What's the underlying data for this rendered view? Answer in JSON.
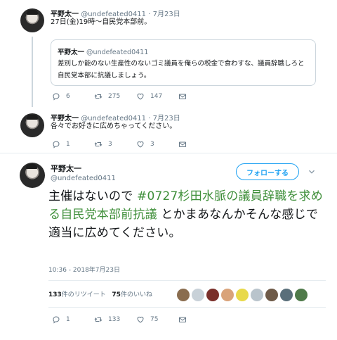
{
  "tweets": [
    {
      "name": "平野太一",
      "handle": "@undefeated0411",
      "dot": "·",
      "date": "7月23日",
      "text": "27日(金)19時～自民党本部前。",
      "quote": {
        "name": "平野太一",
        "handle": "@undefeated0411",
        "text": "差別しか能のない生産性のないゴミ議員を俺らの税金で食わすな、議員辞職しろと自民党本部に抗議しましょう。"
      },
      "replies": "6",
      "retweets": "275",
      "likes": "147"
    },
    {
      "name": "平野太一",
      "handle": "@undefeated0411",
      "dot": "·",
      "date": "7月23日",
      "text": "各々でお好きに広めちゃってください。",
      "replies": "1",
      "retweets": "3",
      "likes": "3"
    }
  ],
  "main": {
    "name": "平野太一",
    "handle": "@undefeated0411",
    "follow_label": "フォローする",
    "text_before": "主催はないので",
    "hashtag": "#0727杉田水脈の議員辞職を求める自民党本部前抗議",
    "text_after": "とかまあなんかそんな感じで適当に広めてください。",
    "timestamp": "10:36 - 2018年7月23日",
    "retweet_count": "133",
    "retweet_label": "件のリツイート",
    "like_count": "75",
    "like_label": "件のいいね",
    "replies": "1",
    "retweets": "133",
    "likes": "75"
  },
  "liker_avatar_colors": [
    "#8a6d4f",
    "#c8d1d8",
    "#7a2f2a",
    "#d9a37a",
    "#e8d94a",
    "#b9c4cc",
    "#6e5a48",
    "#5a6f7a",
    "#4f7a4a"
  ],
  "colors": {
    "link": "#1da1f2",
    "muted": "#657786",
    "border": "#ccd6dd"
  }
}
